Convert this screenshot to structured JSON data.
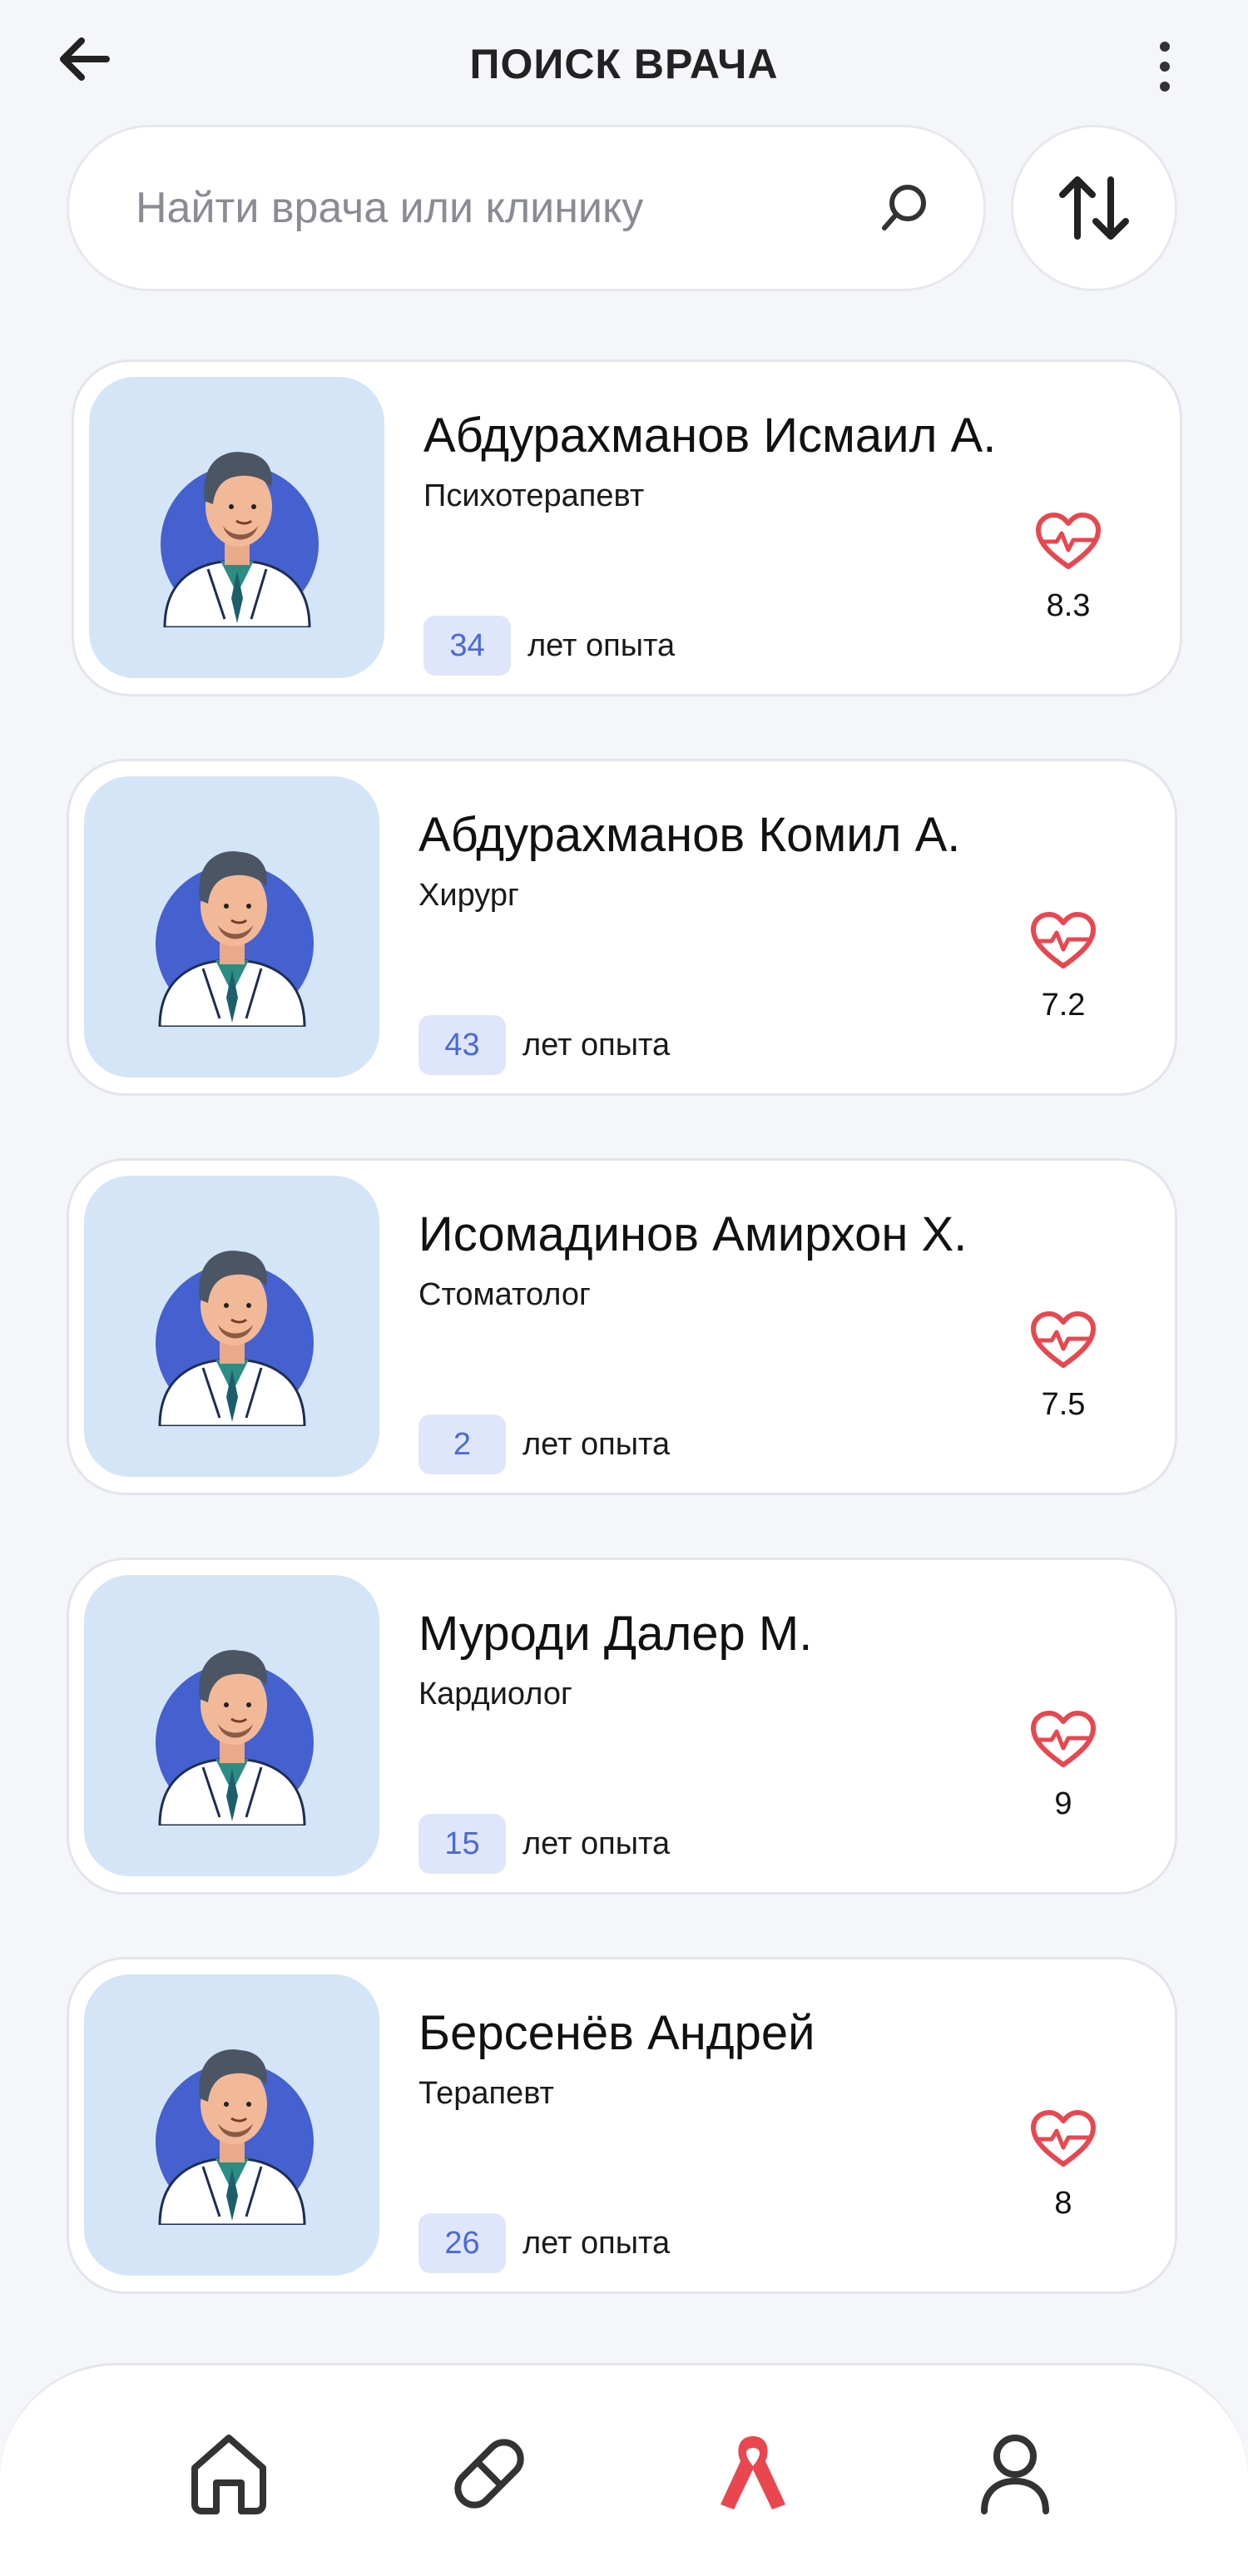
{
  "header": {
    "title": "ПОИСК ВРАЧА"
  },
  "search": {
    "placeholder": "Найти врача или клинику",
    "value": ""
  },
  "doctors": [
    {
      "name": "Абдурахманов Исмаил А.",
      "specialty": "Психотерапевт",
      "experience": "34",
      "experience_label": "лет опыта",
      "rating": "8.3"
    },
    {
      "name": "Абдурахманов Комил А.",
      "specialty": "Хирург",
      "experience": "43",
      "experience_label": "лет опыта",
      "rating": "7.2"
    },
    {
      "name": "Исомадинов Амирхон Х.",
      "specialty": "Стоматолог",
      "experience": "2",
      "experience_label": "лет опыта",
      "rating": "7.5"
    },
    {
      "name": "Муроди Далер М.",
      "specialty": "Кардиолог",
      "experience": "15",
      "experience_label": "лет опыта",
      "rating": "9"
    },
    {
      "name": "Берсенёв Андрей",
      "specialty": "Терапевт",
      "experience": "26",
      "experience_label": "лет опыта",
      "rating": "8"
    }
  ],
  "nav": {
    "items": [
      {
        "icon": "home-icon",
        "active": false
      },
      {
        "icon": "pill-icon",
        "active": false
      },
      {
        "icon": "ribbon-icon",
        "active": true
      },
      {
        "icon": "profile-icon",
        "active": false
      }
    ]
  },
  "colors": {
    "accent": "#e8474f",
    "badge_text": "#4a6ad6",
    "badge_bg": "#dfe6fb",
    "avatar_bg": "#d4e5f8"
  }
}
